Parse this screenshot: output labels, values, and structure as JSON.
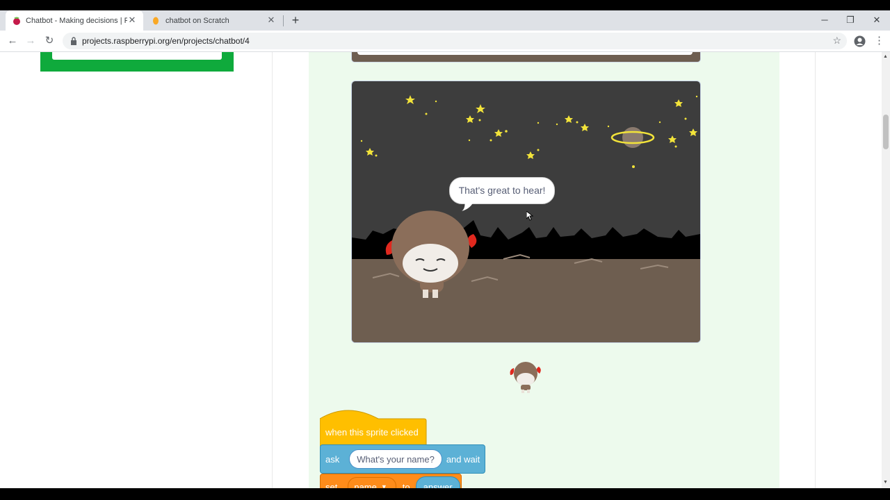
{
  "browser": {
    "tabs": [
      {
        "title": "Chatbot - Making decisions | Ras",
        "active": true
      },
      {
        "title": "chatbot on Scratch",
        "active": false
      }
    ],
    "url": "projects.raspberrypi.org/en/projects/chatbot/4"
  },
  "stage": {
    "speech": "That's great to hear!"
  },
  "blocks": {
    "hat": "when this sprite clicked",
    "ask_label": "ask",
    "ask_value": "What's your name?",
    "ask_suffix": "and wait",
    "set_label": "set",
    "set_var": "name",
    "set_to": "to",
    "set_value": "answer"
  },
  "colors": {
    "green_area": "#edfaed",
    "events_yellow": "#ffbf00",
    "sensing_blue": "#5cb1d6",
    "variables_orange": "#ff8c1a",
    "stage_sky": "#3d3d3d",
    "stage_ground": "#6e5e50",
    "left_green": "#0faa3c"
  }
}
